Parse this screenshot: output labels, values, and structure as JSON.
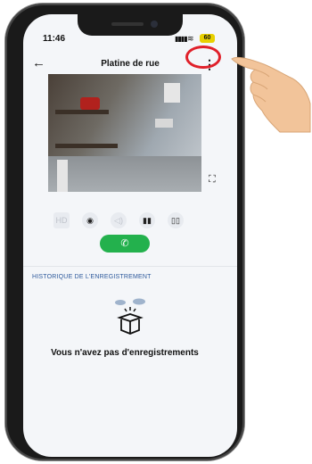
{
  "status_bar": {
    "time": "11:46",
    "signal": "▮▮▮▮",
    "wifi": "≋",
    "battery": "60"
  },
  "header": {
    "back_icon": "←",
    "title": "Platine de rue",
    "menu_icon": "⋮"
  },
  "video": {
    "fullscreen_icon": "⛶"
  },
  "controls": {
    "hd": "HD",
    "snapshot": "◉",
    "speaker": "◁)",
    "door1": "▮▮",
    "door2": "▯▯",
    "call_icon": "✆"
  },
  "history": {
    "label": "HISTORIQUE DE L'ENREGISTREMENT",
    "empty_message": "Vous n'avez pas d'enregistrements"
  },
  "colors": {
    "accent_green": "#23b14d",
    "history_blue": "#2e5a9c",
    "highlight_red": "#e0202a"
  }
}
